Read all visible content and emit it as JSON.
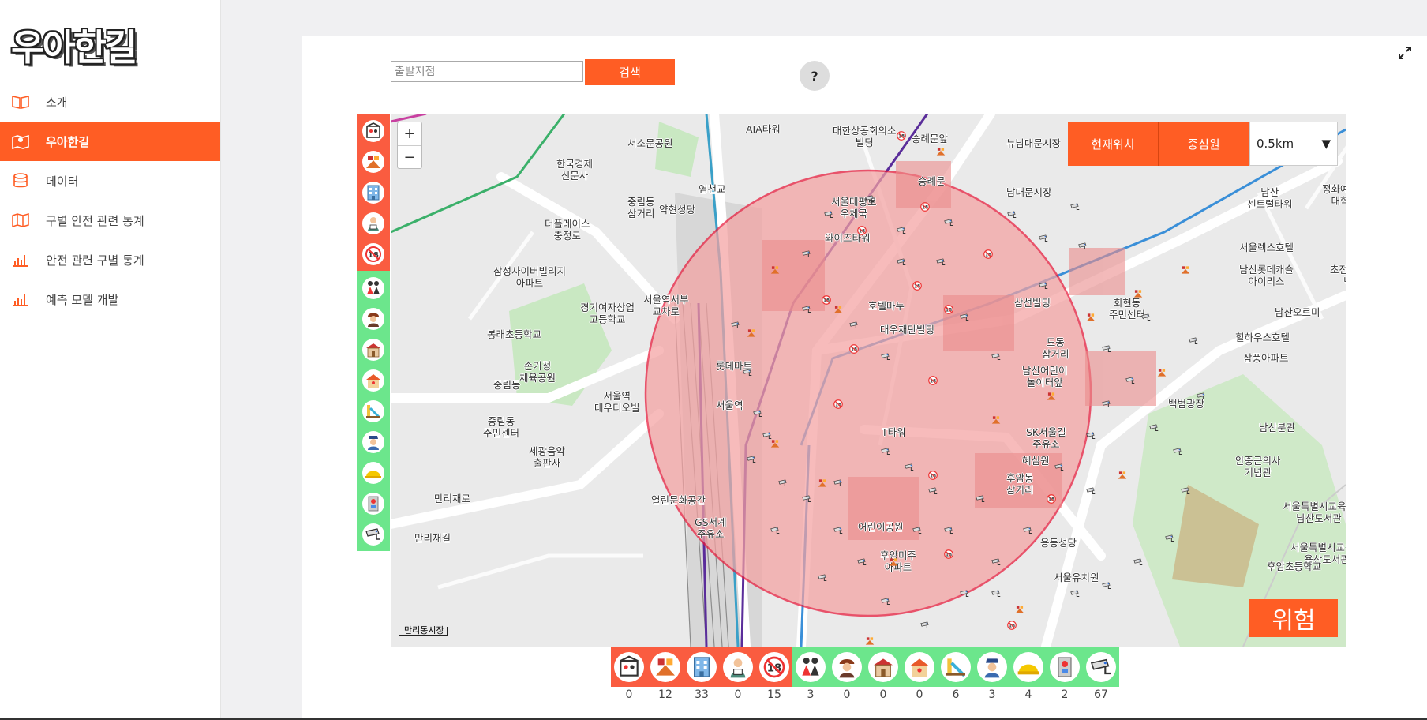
{
  "app": {
    "logo": "우아한길"
  },
  "sidebar": {
    "items": [
      {
        "label": "소개",
        "icon": "book-icon",
        "active": false
      },
      {
        "label": "우아한길",
        "icon": "map-marker-icon",
        "active": true
      },
      {
        "label": "데이터",
        "icon": "database-icon",
        "active": false
      },
      {
        "label": "구별 안전 관련 통계",
        "icon": "map-icon",
        "active": false
      },
      {
        "label": "안전 관련 구별 통계",
        "icon": "bar-chart-icon",
        "active": false
      },
      {
        "label": "예측 모델 개발",
        "icon": "bar-chart-icon",
        "active": false
      }
    ]
  },
  "search": {
    "placeholder": "출발지점",
    "value": "",
    "button": "검색",
    "help": "?"
  },
  "map": {
    "buttons": {
      "current_location": "현재위치",
      "center_circle": "중심원"
    },
    "radius_select": {
      "value": "0.5km"
    },
    "danger_badge": "위험",
    "scale_label": "만리동시장",
    "zoom_in": "+",
    "zoom_out": "−",
    "labels": [
      "AIA타워",
      "대한상공회의소\n빌딩",
      "숭례문앞",
      "뉴남대문시장",
      "서소문공원",
      "한국경제\n신문사",
      "염천교",
      "숭례문",
      "남대문시장",
      "남산\n센트럴타워",
      "정화예술\n대학",
      "중림동\n삼거리",
      "약현성당",
      "서울태평로\n우체국",
      "더플레이스\n충정로",
      "와이즈타워",
      "서울렉스호텔",
      "삼성사이버빌리지\n아파트",
      "남산롯데캐슬\n아이리스",
      "초전섬유퀼트\n박물관",
      "경기여자상업\n고등학교",
      "서울역서부\n교차로",
      "호텔마누",
      "삼선빌딩",
      "회현동\n주민센터",
      "남산오르미",
      "봉래초등학교",
      "대우재단빌딩",
      "도동\n삼거리",
      "힐하우스호텔",
      "삼풍아파트",
      "손기정\n체육공원",
      "롯데마트",
      "남산어린이\n놀이터앞",
      "중림동",
      "서울역\n대우디오빌",
      "서울역",
      "백범광장",
      "중림동\n주민센터",
      "SK서울길\n주유소",
      "남산분관",
      "세광음악\n출판사",
      "T타워",
      "안중근의사\n기념관",
      "혜심원",
      "후암동\n삼거리",
      "열린문화공간",
      "GS서계\n주유소",
      "서울특별시교육청\n남산도서관",
      "어린이공원",
      "용동성당",
      "만리재로",
      "만리재길",
      "후암미주\n아파트",
      "서울특별시교육청\n용산도서관",
      "후암초등학교",
      "서울유치원"
    ]
  },
  "legend": {
    "categories": [
      {
        "icon": "entertainment-icon",
        "group": "danger",
        "count": "0"
      },
      {
        "icon": "bar-pub-icon",
        "group": "danger",
        "count": "12"
      },
      {
        "icon": "hotel-icon",
        "group": "danger",
        "count": "33"
      },
      {
        "icon": "sex-offender-icon",
        "group": "danger",
        "count": "0"
      },
      {
        "icon": "adult-only-icon",
        "group": "danger",
        "count": "15"
      },
      {
        "icon": "children-icon",
        "group": "safe",
        "count": "3"
      },
      {
        "icon": "firefighter-icon",
        "group": "safe",
        "count": "0"
      },
      {
        "icon": "school-icon",
        "group": "safe",
        "count": "0"
      },
      {
        "icon": "kindergarten-icon",
        "group": "safe",
        "count": "0"
      },
      {
        "icon": "playground-icon",
        "group": "safe",
        "count": "6"
      },
      {
        "icon": "police-icon",
        "group": "safe",
        "count": "3"
      },
      {
        "icon": "safety-helmet-icon",
        "group": "safe",
        "count": "4"
      },
      {
        "icon": "emergency-bell-icon",
        "group": "safe",
        "count": "2"
      },
      {
        "icon": "cctv-icon",
        "group": "safe",
        "count": "67"
      }
    ]
  },
  "colors": {
    "accent": "#ff5d24",
    "danger_group": "#fa5c40",
    "safe_group": "#6ce68c",
    "danger_zone": "#f4a6a6",
    "danger_circle": "#e8193a"
  }
}
